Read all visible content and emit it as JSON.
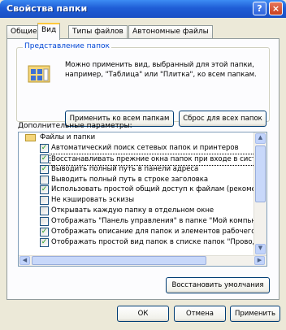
{
  "window": {
    "title": "Свойства папки",
    "help_label": "?",
    "close_label": "×"
  },
  "tabs": [
    {
      "label": "Общие",
      "active": false
    },
    {
      "label": "Вид",
      "active": true
    },
    {
      "label": "Типы файлов",
      "active": false
    },
    {
      "label": "Автономные файлы",
      "active": false
    }
  ],
  "folder_view": {
    "legend": "Представление папок",
    "description": "Можно применить вид, выбранный для этой папки, например, \"Таблица\" или \"Плитка\", ко всем папкам.",
    "apply_all_label": "Применить ко всем папкам",
    "reset_all_label": "Сброс для всех папок"
  },
  "advanced": {
    "label": "Дополнительные параметры:",
    "folder_label": "Файлы и папки",
    "items": [
      {
        "label": "Автоматический поиск сетевых папок и принтеров",
        "checked": true
      },
      {
        "label": "Восстанавливать прежние окна папок при входе в систему",
        "checked": true,
        "selected": true
      },
      {
        "label": "Выводить полный путь в панели адреса",
        "checked": true
      },
      {
        "label": "Выводить полный путь в строке заголовка",
        "checked": false
      },
      {
        "label": "Использовать простой общий доступ к файлам (рекоменд",
        "checked": true
      },
      {
        "label": "Не кэшировать эскизы",
        "checked": false
      },
      {
        "label": "Открывать каждую папку в отдельном окне",
        "checked": false
      },
      {
        "label": "Отображать \"Панель управления\" в папке \"Мой компьют",
        "checked": false
      },
      {
        "label": "Отображать описание для папок и элементов рабочего сто",
        "checked": true
      },
      {
        "label": "Отображать простой вид папок в списке папок \"Проводни",
        "checked": true
      }
    ]
  },
  "buttons": {
    "restore_defaults": "Восстановить умолчания",
    "ok": "ОК",
    "cancel": "Отмена",
    "apply": "Применить"
  },
  "colors": {
    "titlebar": "#1F5DD6",
    "dialog_bg": "#ECE9D8",
    "check": "#21A121"
  }
}
